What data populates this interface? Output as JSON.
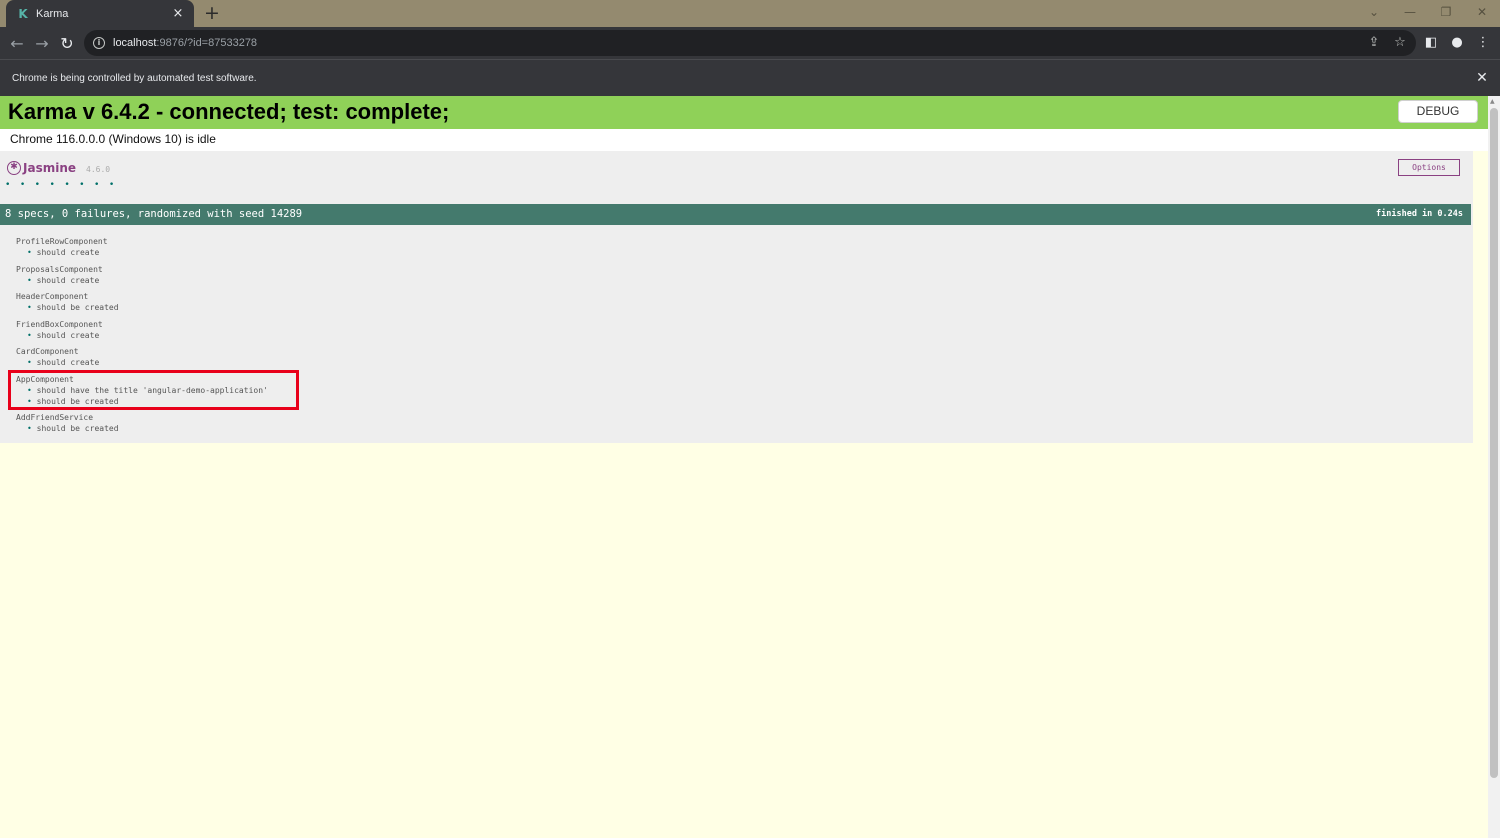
{
  "browser": {
    "tab_title": "Karma",
    "tab_close": "×",
    "new_tab": "+",
    "window_controls": [
      "⌄",
      "—",
      "❐",
      "✕"
    ],
    "url_host": "localhost",
    "url_rest": ":9876/?id=87533278",
    "infobar_text": "Chrome is being controlled by automated test software.",
    "infobar_close": "✕"
  },
  "karma": {
    "title": "Karma v 6.4.2 - connected; test: complete;",
    "debug_label": "DEBUG",
    "browser_status": "Chrome 116.0.0.0 (Windows 10) is idle"
  },
  "jasmine": {
    "name": "Jasmine",
    "version": "4.6.0",
    "options_label": "Options",
    "dots": "• • • • • • • •",
    "summary": "8 specs, 0 failures, randomized with seed 14289",
    "duration": "finished in 0.24s",
    "suites": [
      {
        "name": "ProfileRowComponent",
        "specs": [
          "should create"
        ]
      },
      {
        "name": "ProposalsComponent",
        "specs": [
          "should create"
        ]
      },
      {
        "name": "HeaderComponent",
        "specs": [
          "should be created"
        ]
      },
      {
        "name": "FriendBoxComponent",
        "specs": [
          "should create"
        ]
      },
      {
        "name": "CardComponent",
        "specs": [
          "should create"
        ]
      },
      {
        "name": "AppComponent",
        "specs": [
          "should have the title 'angular-demo-application'",
          "should be created"
        ]
      },
      {
        "name": "AddFriendService",
        "specs": [
          "should be created"
        ]
      }
    ]
  },
  "colors": {
    "karma_green": "#8fd158",
    "jasmine_bar": "#447a6d",
    "highlight": "#e8001a"
  }
}
